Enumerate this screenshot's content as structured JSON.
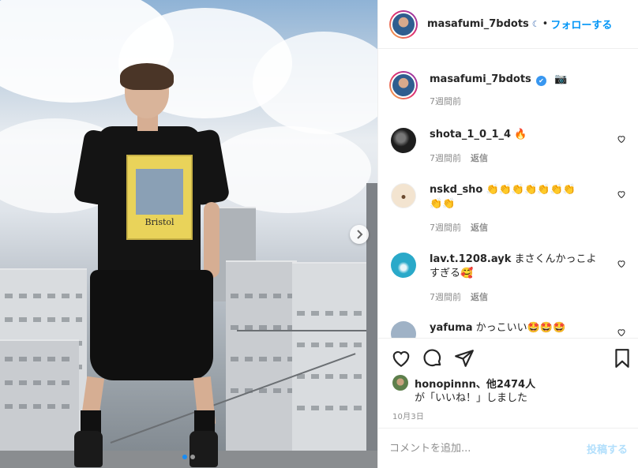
{
  "post": {
    "username": "masafumi_7bdots",
    "follow_label": "フォローする",
    "dot": "•",
    "moon_glyph": "☾",
    "verified_glyph": "✔",
    "camera_glyph": "📷",
    "caption_time": "7週間前",
    "print_text": "Bristol"
  },
  "comments": [
    {
      "user": "shota_1_0_1_4",
      "text": "🔥",
      "time": "7週間前",
      "reply": "返信",
      "avatar_color": "#2b2b2b"
    },
    {
      "user": "nskd_sho",
      "text": "👏👏👏👏👏👏👏",
      "text2": "👏👏",
      "time": "7週間前",
      "reply": "返信",
      "avatar_color": "#f3e4d0"
    },
    {
      "user": "lav.t.1208.ayk",
      "text": "まさくんかっこよ",
      "text2": "すぎる🥰",
      "time": "7週間前",
      "reply": "返信",
      "avatar_color": "#2aa9c9"
    },
    {
      "user": "yafuma",
      "text": "かっこいい🤩🤩🤩",
      "avatar_color": "#9fb2c6"
    }
  ],
  "likes": {
    "by": "honopinnn",
    "others": "、他2474人",
    "suffix": "が「いいね！」しました"
  },
  "date": "10月3日",
  "add_comment": {
    "placeholder": "コメントを追加...",
    "post_label": "投稿する"
  },
  "colors": {
    "accent": "#0095f6",
    "post_disabled": "#b2dffc",
    "active_dot": "#1a8cf2"
  },
  "icons": [
    "moon-icon",
    "verified-badge-icon",
    "camera-icon",
    "heart-icon",
    "comment-icon",
    "share-icon",
    "bookmark-icon",
    "chevron-right-icon"
  ]
}
